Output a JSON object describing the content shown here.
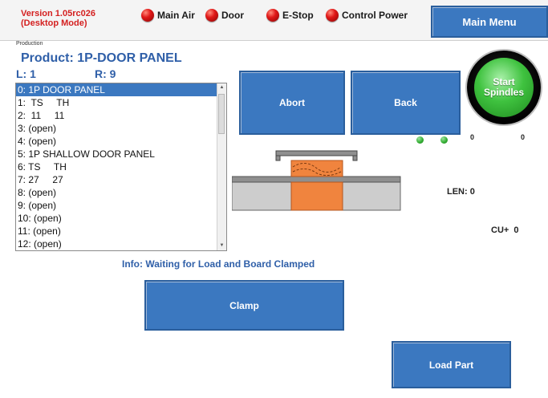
{
  "header": {
    "version_line1": "Version 1.05rc026",
    "version_line2": "(Desktop Mode)",
    "indicators": [
      {
        "label": "Main Air"
      },
      {
        "label": "Door"
      },
      {
        "label": "E-Stop"
      },
      {
        "label": "Control Power"
      }
    ],
    "main_menu_label": "Main Menu"
  },
  "section_label": "Production",
  "product_label": "Product: 1P-DOOR PANEL",
  "left_value": "L: 1",
  "right_value": "R: 9",
  "list": {
    "selected_index": 0,
    "items": [
      "0: 1P DOOR PANEL",
      "1:  TS     TH",
      "2:  11     11",
      "3: (open)",
      "4: (open)",
      "5: 1P SHALLOW DOOR PANEL",
      "6: TS     TH",
      "7: 27     27",
      "8: (open)",
      "9: (open)",
      "10: (open)",
      "11: (open)",
      "12: (open)"
    ]
  },
  "buttons": {
    "abort": "Abort",
    "back": "Back",
    "clamp": "Clamp",
    "load_part": "Load Part",
    "start_line1": "Start",
    "start_line2": "Spindles"
  },
  "readouts": {
    "left_count": "0",
    "right_count": "0",
    "len": "LEN: 0",
    "cu": "CU+  0"
  },
  "info_text": "Info: Waiting for Load and Board Clamped",
  "colors": {
    "button_blue": "#3b78c0",
    "title_blue": "#2f5fa8",
    "version_red": "#d42020",
    "indicator_red": "#e01818",
    "status_green": "#35b035",
    "part_orange": "#f0843e"
  }
}
